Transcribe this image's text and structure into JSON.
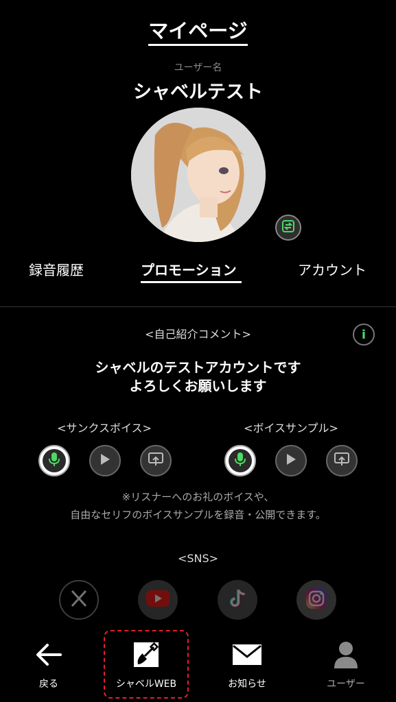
{
  "header": {
    "title": "マイページ"
  },
  "profile": {
    "username_caption": "ユーザー名",
    "username": "シャベルテスト"
  },
  "tabs": [
    {
      "label": "録音履歴",
      "active": false
    },
    {
      "label": "プロモーション",
      "active": true
    },
    {
      "label": "アカウント",
      "active": false
    }
  ],
  "comment": {
    "heading": "<自己紹介コメント>",
    "info_label": "i",
    "line1": "シャベルのテストアカウントです",
    "line2": "よろしくお願いします"
  },
  "voices": {
    "thanks_heading": "<サンクスボイス>",
    "sample_heading": "<ボイスサンプル>",
    "note_line1": "※リスナーへのお礼のボイスや、",
    "note_line2": "自由なセリフのボイスサンプルを録音・公開できます。"
  },
  "sns": {
    "heading": "<SNS>",
    "items": [
      {
        "icon": "x-icon"
      },
      {
        "icon": "youtube-icon"
      },
      {
        "icon": "tiktok-icon"
      },
      {
        "icon": "instagram-icon"
      }
    ]
  },
  "bottom_nav": {
    "back": "戻る",
    "web": "シャベルWEB",
    "notifications": "お知らせ",
    "user": "ユーザー"
  },
  "colors": {
    "accent_green": "#4cd964",
    "highlight_red": "#e2202a",
    "background": "#000000"
  }
}
